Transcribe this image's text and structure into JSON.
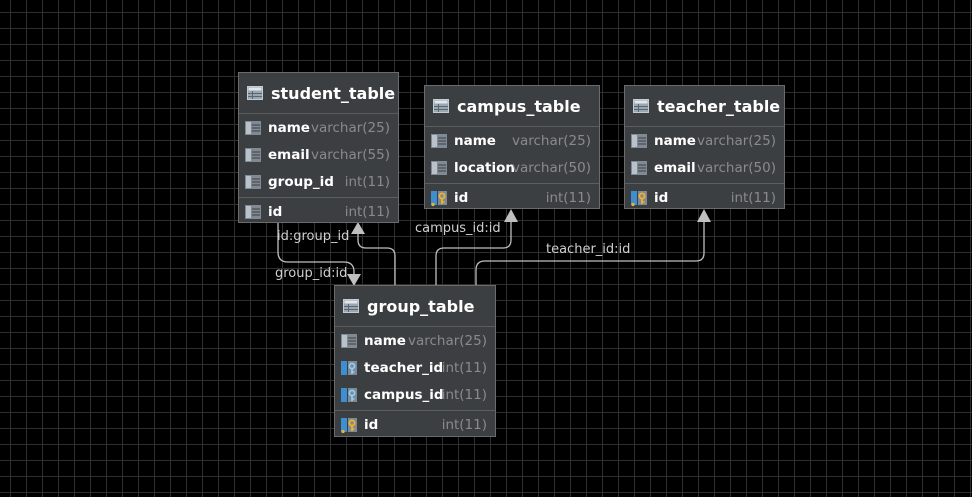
{
  "tables": {
    "student": {
      "title": "student_table",
      "columns": [
        {
          "name": "name",
          "type": "varchar(25)"
        },
        {
          "name": "email",
          "type": "varchar(55)"
        },
        {
          "name": "group_id",
          "type": "int(11)"
        }
      ],
      "key": {
        "name": "id",
        "type": "int(11)"
      }
    },
    "campus": {
      "title": "campus_table",
      "columns": [
        {
          "name": "name",
          "type": "varchar(25)"
        },
        {
          "name": "location",
          "type": "varchar(50)"
        }
      ],
      "key": {
        "name": "id",
        "type": "int(11)"
      }
    },
    "teacher": {
      "title": "teacher_table",
      "columns": [
        {
          "name": "name",
          "type": "varchar(25)"
        },
        {
          "name": "email",
          "type": "varchar(50)"
        }
      ],
      "key": {
        "name": "id",
        "type": "int(11)"
      }
    },
    "group": {
      "title": "group_table",
      "columns": [
        {
          "name": "name",
          "type": "varchar(25)"
        },
        {
          "name": "teacher_id",
          "type": "int(11)"
        },
        {
          "name": "campus_id",
          "type": "int(11)"
        }
      ],
      "key": {
        "name": "id",
        "type": "int(11)"
      }
    }
  },
  "relations": {
    "student_to_group": "id:group_id",
    "group_to_student": "group_id:id",
    "group_to_campus": "campus_id:id",
    "group_to_teacher": "teacher_id:id"
  },
  "colors": {
    "background": "#000000",
    "grid": "#2f2f2f",
    "table_bg": "#3c3f41",
    "edge": "#bfbfbf",
    "type_text": "#8a8a8a",
    "key_gold": "#d8a02a",
    "fk_blue": "#3d8fd1"
  }
}
